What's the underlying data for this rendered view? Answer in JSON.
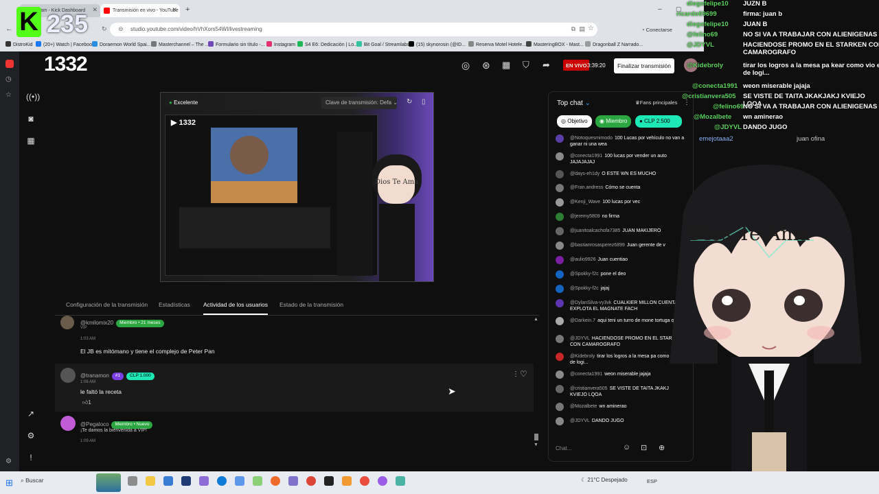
{
  "browser": {
    "tabs": [
      {
        "label": "Stream - Kick Dashboard",
        "color": "#53fc18"
      },
      {
        "label": "Transmisión en vivo - YouTube",
        "color": "#ff0000"
      }
    ],
    "url": "studio.youtube.com/video/hVhXors54WI/livestreaming",
    "connect_label": "Conectarse",
    "bookmarks": [
      "DistroKid",
      "(20+) Watch | Facebook",
      "Doraemon World Spai...",
      "Masterchannel – The ...",
      "Formulario sin título -...",
      "Instagram",
      "S4 E6: Dedicación | Lo...",
      "Bit Goal / Streamlabs",
      "(15) skynorosin (@ID...",
      "Reserva Motel Hotele...",
      "MasteringBOX - Mast...",
      "Dragonball Z Narrado..."
    ]
  },
  "kick_overlay": {
    "count": "235"
  },
  "studio": {
    "channel_number": "1332",
    "live_badge": "EN VIVO",
    "live_time": "3:39:20",
    "end_button": "Finalizar transmisión",
    "preview": {
      "quality": "Excelente",
      "stream_key_label": "Clave de transmisión: Defa"
    },
    "tabs": [
      "Configuración de la transmisión",
      "Estadísticas",
      "Actividad de los usuarios",
      "Estado de la transmisión"
    ],
    "active_tab": 2,
    "comments": [
      {
        "user": "@kmilomix20",
        "badge": "Miembro • 21 meses",
        "badge2": "VIP",
        "time": "1:03 AM",
        "text": "El JB es mitómano y tiene el complejo de Peter Pan"
      },
      {
        "user": "@tranamon",
        "badge": "#1",
        "amount": "CLP 1.000",
        "time": "1:06 AM",
        "text": "le faltó la receta",
        "likes": "1"
      },
      {
        "user": "@Pegaloco",
        "badge": "Miembro • Nuevo",
        "time": "1:09 AM",
        "text": "¡Te damos la bienvenida a VIP!"
      }
    ]
  },
  "livechat": {
    "title": "Top chat",
    "top_fans": "Fans principales",
    "filters": [
      "Objetivo",
      "Miembro",
      "CLP 2.500"
    ],
    "placeholder": "Chat...",
    "messages": [
      {
        "user": "@Notoquesmimodo",
        "text": "100 Lucas por vehículo no van a ganar ni una wea"
      },
      {
        "user": "@conecta1991",
        "text": "100 lucas por vender un auto JAJAJAJAJ"
      },
      {
        "user": "@days-eh1dy",
        "text": "O ESTE WN ES MUCHO"
      },
      {
        "user": "@Fran.andress",
        "text": "Cómo se cuenta"
      },
      {
        "user": "@Kenji_Wave",
        "text": "100 lucas por vec"
      },
      {
        "user": "@jeremy5809",
        "text": "no firma"
      },
      {
        "user": "@juanitoalcachofa7385",
        "text": "JUAN MAKIJERO"
      },
      {
        "user": "@bastianrosasperez6899",
        "text": "Juan gerente de v"
      },
      {
        "user": "@aulio9926",
        "text": "Juan cuentiao"
      },
      {
        "user": "@Spokky-f2c",
        "text": "pone el deo"
      },
      {
        "user": "@Spokky-f2c",
        "text": "jajaj"
      },
      {
        "user": "@DylanSilva-vy3vk",
        "text": "CUALKIER MILLON CUENTA EXPLOTA EL MAGNATE FACH"
      },
      {
        "user": "@Darkein.7",
        "text": "aqui teni un turro de mone tortuga qla"
      },
      {
        "user": "@JDYVL",
        "text": "HACIENDOSE PROMO EN EL STARKEN CON CAMAROGRAFO"
      },
      {
        "user": "@Kidebroly",
        "text": "tirar los logros a la mesa pa como vio es de logi..."
      },
      {
        "user": "@conecta1991",
        "text": "weon miserable jajaja"
      },
      {
        "user": "@cristianvera505",
        "text": "SE VISTE DE TAITA JKAKJ KVIEJO LQOA"
      },
      {
        "user": "@Mozalbete",
        "text": "wn aminerao"
      },
      {
        "user": "@JDYVL",
        "text": "DANDO JUGO"
      }
    ]
  },
  "overlay_chat": [
    {
      "user": "diegofelipe10",
      "text": "JUZN B"
    },
    {
      "user": "ricardo69699",
      "text": "firma: juan b"
    },
    {
      "user": "diegofelipe10",
      "text": "JUAN B"
    },
    {
      "user": "@felino69",
      "text": "NO SI VA A TRABAJAR CON ALIENIGENAS"
    },
    {
      "user": "@JDYVL",
      "text": "HACIENDOSE PROMO EN EL STARKEN CON CAMAROGRAFO"
    },
    {
      "user": "@Kidebroly",
      "text": "tirar los logros a la mesa pa kear como vio es de logi..."
    },
    {
      "user": "@conecta1991",
      "text": "weon miserable jajaja"
    },
    {
      "user": "@cristianvera505",
      "text": "SE VISTE DE TAITA JKAKJAKJ KVIEJO LQOA"
    },
    {
      "user": "@felino69",
      "text": "NO SI VA A TRABAJAR CON ALIENIGENAS"
    },
    {
      "user": "@Mozalbete",
      "text": "wn aminerao"
    },
    {
      "user": "@JDYVL",
      "text": "DANDO JUGO"
    },
    {
      "user": "emejotaaa2",
      "text": "juan ofina"
    }
  ],
  "avatar": {
    "caption": "Dios Te Ama",
    "caption_small": "Dios Te Ama"
  },
  "taskbar": {
    "search": "Buscar",
    "weather": "21°C Despejado",
    "lang": "ESP"
  }
}
